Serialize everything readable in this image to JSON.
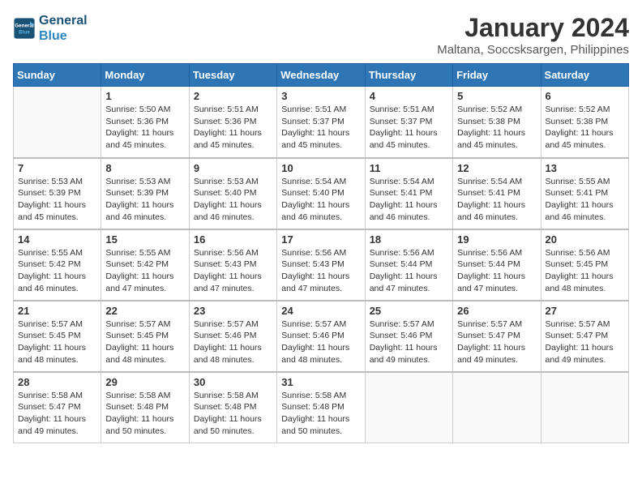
{
  "logo": {
    "line1": "General",
    "line2": "Blue"
  },
  "title": "January 2024",
  "subtitle": "Maltana, Soccsksargen, Philippines",
  "headers": [
    "Sunday",
    "Monday",
    "Tuesday",
    "Wednesday",
    "Thursday",
    "Friday",
    "Saturday"
  ],
  "weeks": [
    [
      {
        "day": "",
        "info": ""
      },
      {
        "day": "1",
        "info": "Sunrise: 5:50 AM\nSunset: 5:36 PM\nDaylight: 11 hours\nand 45 minutes."
      },
      {
        "day": "2",
        "info": "Sunrise: 5:51 AM\nSunset: 5:36 PM\nDaylight: 11 hours\nand 45 minutes."
      },
      {
        "day": "3",
        "info": "Sunrise: 5:51 AM\nSunset: 5:37 PM\nDaylight: 11 hours\nand 45 minutes."
      },
      {
        "day": "4",
        "info": "Sunrise: 5:51 AM\nSunset: 5:37 PM\nDaylight: 11 hours\nand 45 minutes."
      },
      {
        "day": "5",
        "info": "Sunrise: 5:52 AM\nSunset: 5:38 PM\nDaylight: 11 hours\nand 45 minutes."
      },
      {
        "day": "6",
        "info": "Sunrise: 5:52 AM\nSunset: 5:38 PM\nDaylight: 11 hours\nand 45 minutes."
      }
    ],
    [
      {
        "day": "7",
        "info": "Sunrise: 5:53 AM\nSunset: 5:39 PM\nDaylight: 11 hours\nand 45 minutes."
      },
      {
        "day": "8",
        "info": "Sunrise: 5:53 AM\nSunset: 5:39 PM\nDaylight: 11 hours\nand 46 minutes."
      },
      {
        "day": "9",
        "info": "Sunrise: 5:53 AM\nSunset: 5:40 PM\nDaylight: 11 hours\nand 46 minutes."
      },
      {
        "day": "10",
        "info": "Sunrise: 5:54 AM\nSunset: 5:40 PM\nDaylight: 11 hours\nand 46 minutes."
      },
      {
        "day": "11",
        "info": "Sunrise: 5:54 AM\nSunset: 5:41 PM\nDaylight: 11 hours\nand 46 minutes."
      },
      {
        "day": "12",
        "info": "Sunrise: 5:54 AM\nSunset: 5:41 PM\nDaylight: 11 hours\nand 46 minutes."
      },
      {
        "day": "13",
        "info": "Sunrise: 5:55 AM\nSunset: 5:41 PM\nDaylight: 11 hours\nand 46 minutes."
      }
    ],
    [
      {
        "day": "14",
        "info": "Sunrise: 5:55 AM\nSunset: 5:42 PM\nDaylight: 11 hours\nand 46 minutes."
      },
      {
        "day": "15",
        "info": "Sunrise: 5:55 AM\nSunset: 5:42 PM\nDaylight: 11 hours\nand 47 minutes."
      },
      {
        "day": "16",
        "info": "Sunrise: 5:56 AM\nSunset: 5:43 PM\nDaylight: 11 hours\nand 47 minutes."
      },
      {
        "day": "17",
        "info": "Sunrise: 5:56 AM\nSunset: 5:43 PM\nDaylight: 11 hours\nand 47 minutes."
      },
      {
        "day": "18",
        "info": "Sunrise: 5:56 AM\nSunset: 5:44 PM\nDaylight: 11 hours\nand 47 minutes."
      },
      {
        "day": "19",
        "info": "Sunrise: 5:56 AM\nSunset: 5:44 PM\nDaylight: 11 hours\nand 47 minutes."
      },
      {
        "day": "20",
        "info": "Sunrise: 5:56 AM\nSunset: 5:45 PM\nDaylight: 11 hours\nand 48 minutes."
      }
    ],
    [
      {
        "day": "21",
        "info": "Sunrise: 5:57 AM\nSunset: 5:45 PM\nDaylight: 11 hours\nand 48 minutes."
      },
      {
        "day": "22",
        "info": "Sunrise: 5:57 AM\nSunset: 5:45 PM\nDaylight: 11 hours\nand 48 minutes."
      },
      {
        "day": "23",
        "info": "Sunrise: 5:57 AM\nSunset: 5:46 PM\nDaylight: 11 hours\nand 48 minutes."
      },
      {
        "day": "24",
        "info": "Sunrise: 5:57 AM\nSunset: 5:46 PM\nDaylight: 11 hours\nand 48 minutes."
      },
      {
        "day": "25",
        "info": "Sunrise: 5:57 AM\nSunset: 5:46 PM\nDaylight: 11 hours\nand 49 minutes."
      },
      {
        "day": "26",
        "info": "Sunrise: 5:57 AM\nSunset: 5:47 PM\nDaylight: 11 hours\nand 49 minutes."
      },
      {
        "day": "27",
        "info": "Sunrise: 5:57 AM\nSunset: 5:47 PM\nDaylight: 11 hours\nand 49 minutes."
      }
    ],
    [
      {
        "day": "28",
        "info": "Sunrise: 5:58 AM\nSunset: 5:47 PM\nDaylight: 11 hours\nand 49 minutes."
      },
      {
        "day": "29",
        "info": "Sunrise: 5:58 AM\nSunset: 5:48 PM\nDaylight: 11 hours\nand 50 minutes."
      },
      {
        "day": "30",
        "info": "Sunrise: 5:58 AM\nSunset: 5:48 PM\nDaylight: 11 hours\nand 50 minutes."
      },
      {
        "day": "31",
        "info": "Sunrise: 5:58 AM\nSunset: 5:48 PM\nDaylight: 11 hours\nand 50 minutes."
      },
      {
        "day": "",
        "info": ""
      },
      {
        "day": "",
        "info": ""
      },
      {
        "day": "",
        "info": ""
      }
    ]
  ]
}
